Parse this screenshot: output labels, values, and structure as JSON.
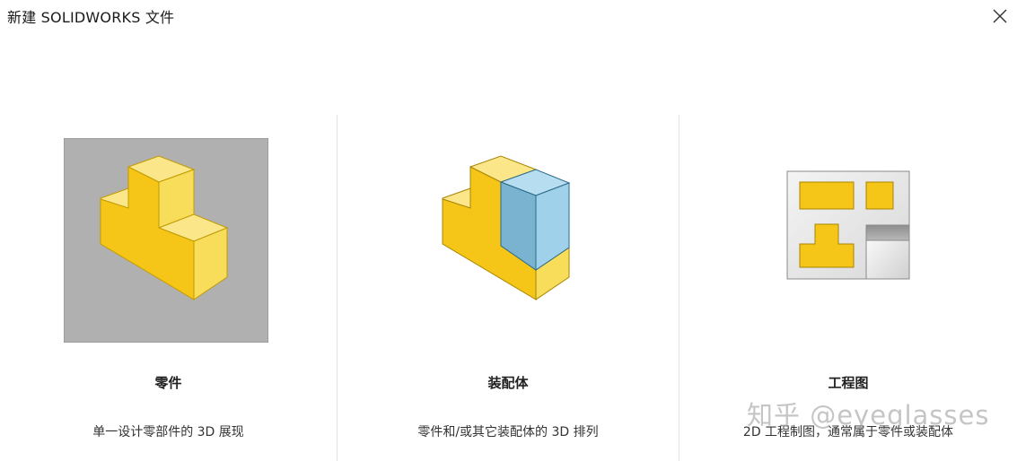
{
  "window": {
    "title": "新建 SOLIDWORKS 文件",
    "close_icon": "close-icon"
  },
  "options": [
    {
      "title": "零件",
      "description": "单一设计零部件的 3D 展现",
      "icon": "part-icon",
      "selected": true
    },
    {
      "title": "装配体",
      "description": "零件和/或其它装配体的 3D 排列",
      "icon": "assembly-icon",
      "selected": false
    },
    {
      "title": "工程图",
      "description": "2D 工程制图，通常属于零件或装配体",
      "icon": "drawing-icon",
      "selected": false
    }
  ],
  "watermark": "知乎 @eyeglasses",
  "colors": {
    "selected_bg": "#b0b0b0",
    "part_yellow": "#f5c518",
    "part_yellow_light": "#fbe57a",
    "assembly_blue": "#8cc7e3",
    "divider": "#e3e3e3"
  }
}
